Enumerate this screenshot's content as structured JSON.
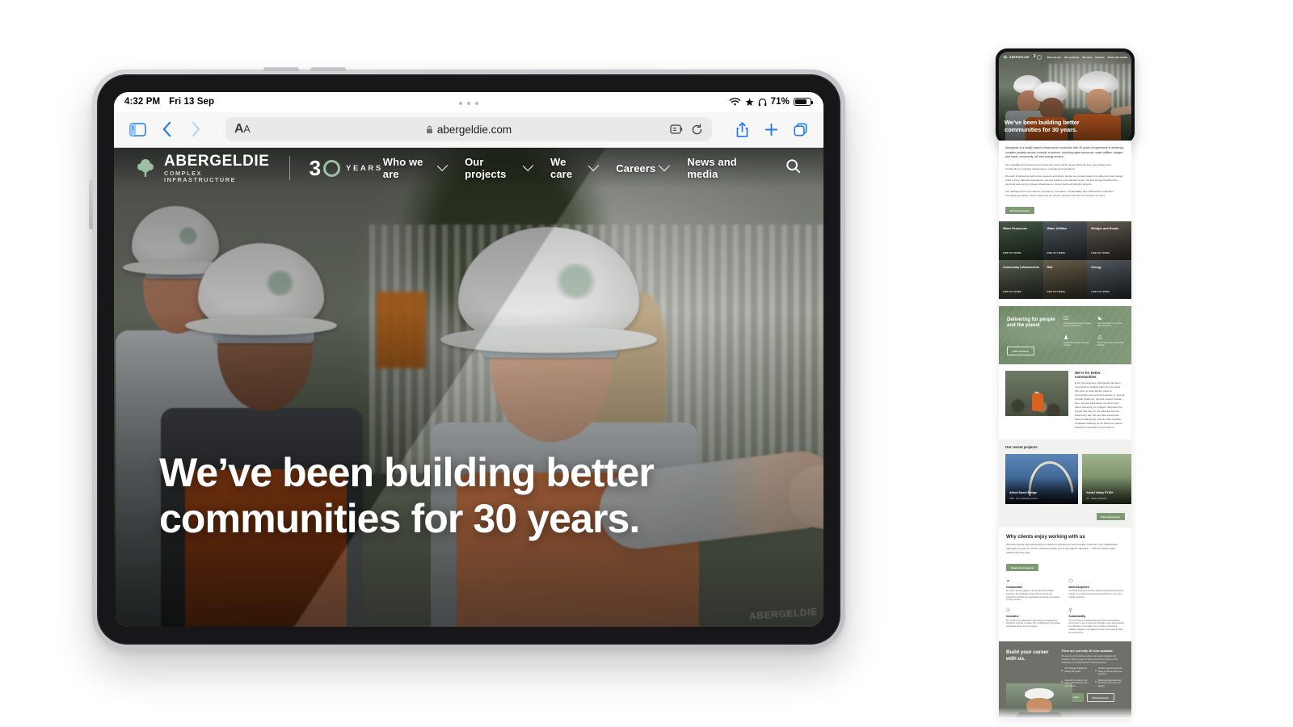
{
  "device": {
    "status_bar": {
      "time": "4:32 PM",
      "date": "Fri 13 Sep",
      "battery_percent": "71%",
      "icons": [
        "wifi-icon",
        "star-icon",
        "headphones-icon",
        "battery-icon"
      ]
    },
    "multitask_handle": "three-dots-handle"
  },
  "browser": {
    "name": "Safari",
    "sidebar_label": "Show Sidebar",
    "back_label": "Back",
    "forward_label": "Forward",
    "text_size_label": "AA",
    "url": "abergeldie.com",
    "lock_label": "Secure connection",
    "reader_label": "Reader",
    "reload_label": "Reload",
    "share_label": "Share",
    "new_tab_label": "New Tab",
    "tabs_label": "Show All Tabs"
  },
  "site": {
    "brand": {
      "name": "ABERGELDIE",
      "tagline": "COMPLEX INFRASTRUCTURE",
      "anniversary_number": "3",
      "anniversary_word": "YEARS"
    },
    "nav": [
      {
        "label": "Who we are",
        "has_dropdown": true
      },
      {
        "label": "Our projects",
        "has_dropdown": true
      },
      {
        "label": "We care",
        "has_dropdown": true
      },
      {
        "label": "Careers",
        "has_dropdown": true
      },
      {
        "label": "News and media",
        "has_dropdown": false
      }
    ],
    "search_label": "Search",
    "hero": {
      "line1": "We’ve been building better",
      "line2": "communities for 30 years."
    },
    "colors": {
      "accent_green": "#7e9a74",
      "logo_green": "#9dbfa2",
      "vest_orange": "#e8601b",
      "safari_blue": "#1a7cf0"
    }
  },
  "preview": {
    "hero": {
      "line1": "We’ve been building better",
      "line2": "communities for 30 years."
    },
    "nav": [
      "Who we are",
      "Our projects",
      "We care",
      "Careers",
      "News and media"
    ],
    "intro": {
      "lead": "Abergeldie is a locally owned infrastructure contractor with 30 years of experience in delivering complex projects across a variety of sectors, including water resources, water utilities, bridges and roads, community, rail and energy sectors.",
      "p2": "Our capability and experience is broad and covers all the project lifecycle from early design and construction to ongoing maintenance, renewals and operations.",
      "p3": "We work in delivering and remote projects and where people are remote based on a safe and clear design, build, survey, data and assistance covering stations and maintain works, rail and energy infrastructure, electrical and energy storage infrastructure, marine plant and pipeline projects.",
      "p4": "Our dedicated and committed to excellence, innovation, sustainability and collaboration underpins everything we deliver, and is valued by our clients, partners and the communities we serve.",
      "cta": "Our track record"
    },
    "sectors": [
      {
        "title": "Water Resources",
        "link": "FIND OUT MORE"
      },
      {
        "title": "Water Utilities",
        "link": "FIND OUT MORE"
      },
      {
        "title": "Bridges and Roads",
        "link": "FIND OUT MORE"
      },
      {
        "title": "Community Infrastructure",
        "link": "FIND OUT MORE"
      },
      {
        "title": "Rail",
        "link": "FIND OUT MORE"
      },
      {
        "title": "Energy",
        "link": "FIND OUT MORE"
      }
    ],
    "planet": {
      "title_line1": "Delivering for people",
      "title_line2": "and the planet",
      "cta": "Find out more",
      "features": [
        {
          "icon": "leaf-check-icon",
          "text": "Our integrated approach to safety and the environment"
        },
        {
          "icon": "people-icon",
          "text": "Our commitment to our people and communities"
        },
        {
          "icon": "person-icon",
          "text": "Supporting local jobs and local suppliers"
        },
        {
          "icon": "recycle-icon",
          "text": "Reducing emissions and carbon footprint"
        }
      ]
    },
    "communities": {
      "title_line1": "We’re for better",
      "title_line2": "communities",
      "body": "From the beginning, Abergeldie has been committed to building better communities. We strive to bring lasting value to communities we work and operate in, and we provide challenge, beyond reward, donate time, we give back about our works and about delivering our projects. Empower the people that stay on the infrastructure we build every day. We are also passionate about creating jobs, and we work towards workplace diversity as we place our values, respected, and able to grow with us."
    },
    "projects": {
      "title": "Our recent projects",
      "cards": [
        {
          "title": "Alfred Street Bridge",
          "meta": "NSW  ·  City of Newcastle Council"
        },
        {
          "title": "Yuntel Valley FY25+",
          "meta": "VIC  ·  Water Corporation"
        }
      ],
      "cta": "View all projects"
    },
    "why": {
      "title": "Why clients enjoy working with us",
      "body": "We work closely and openly with our clients to achieve the best possible outcomes. Our collaborative approach ensures our work is delivered safely and to the highest standard — with our clients’ goals realised at every step.",
      "cta": "Read all our awards",
      "items": [
        {
          "icon": "handshake-icon",
          "title": "Collaborative",
          "text": "We deliver strong, together to achieve the best possible outcomes. We collaborate closely with our clients and contractors, and offer key opportunities to find the best solution in every scenario."
        },
        {
          "icon": "hexagon-icon",
          "title": "Multi-disciplined",
          "text": "Our broad experience across a variety of disciplines and service enables us to challenge and find better solutions to even more complex problems."
        },
        {
          "icon": "lightbulb-icon",
          "title": "Innovative",
          "text": "We combine the professional engineering and management disciplines to create, innovate, offer a collaborative, personalise and flexible service for every project."
        },
        {
          "icon": "leaf-icon",
          "title": "Sustainability",
          "text": "Our commitment to sustainability goes beyond providing the environment to every project we undertake. As we strive towards the elimination of our waste, heat, providing minimal and scalable strategies, and partial part of the communities in which we work and live."
        }
      ]
    },
    "career": {
      "title_line1": "Build your career",
      "title_line2": "with us.",
      "right_title": "There are currently 26 roles available",
      "right_body": "The success of our business relies on our people’s passion and dedication. When you join our team, you’ll join the industry’s most challenging, most interesting and rewarding projects.",
      "bullets": [
        "We challenge, support and develop our people",
        "We offer a genuine path from where you start to where you want to go",
        "Grow with us, build on your career with pathways to suit your success",
        "Delivering projects and team that bring out the best in us together"
      ],
      "buttons": [
        "Apply now",
        "Find out more"
      ]
    }
  }
}
